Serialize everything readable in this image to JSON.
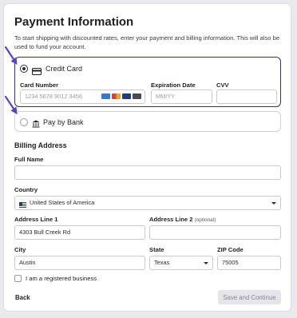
{
  "title": "Payment Information",
  "subtitle": "To start shipping with discounted rates, enter your payment and billing information. This will also be used to fund your account.",
  "payment_methods": {
    "credit_card": {
      "label": "Credit Card",
      "selected": true
    },
    "bank": {
      "label": "Pay by Bank",
      "selected": false
    }
  },
  "card_form": {
    "card_number_label": "Card Number",
    "card_number_placeholder": "1234 5678 9012 3456",
    "expiration_label": "Expiration Date",
    "expiration_placeholder": "MM/YY",
    "cvv_label": "CVV",
    "cvv_placeholder": ""
  },
  "billing": {
    "section_title": "Billing Address",
    "full_name_label": "Full Name",
    "full_name_value": "",
    "country_label": "Country",
    "country_value": "United States of America",
    "address1_label": "Address Line 1",
    "address1_value": "4303 Bull Creek Rd",
    "address2_label": "Address Line 2",
    "address2_optional": "(optional)",
    "address2_value": "",
    "city_label": "City",
    "city_value": "Austin",
    "state_label": "State",
    "state_value": "Texas",
    "zip_label": "ZIP Code",
    "zip_value": "75005"
  },
  "business_checkbox": {
    "label": "I am a registered business",
    "checked": false
  },
  "buttons": {
    "back": "Back",
    "save": "Save and Continue"
  },
  "colors": {
    "selected_border": "#3e2a86",
    "annotation_arrow": "#5a3fd6",
    "disabled_button": "#e4e4ea"
  },
  "icons": [
    "credit-card-icon",
    "bank-icon",
    "amex-icon",
    "mastercard-icon",
    "visa-icon",
    "discover-icon",
    "us-flag-icon",
    "chevron-down-icon"
  ]
}
